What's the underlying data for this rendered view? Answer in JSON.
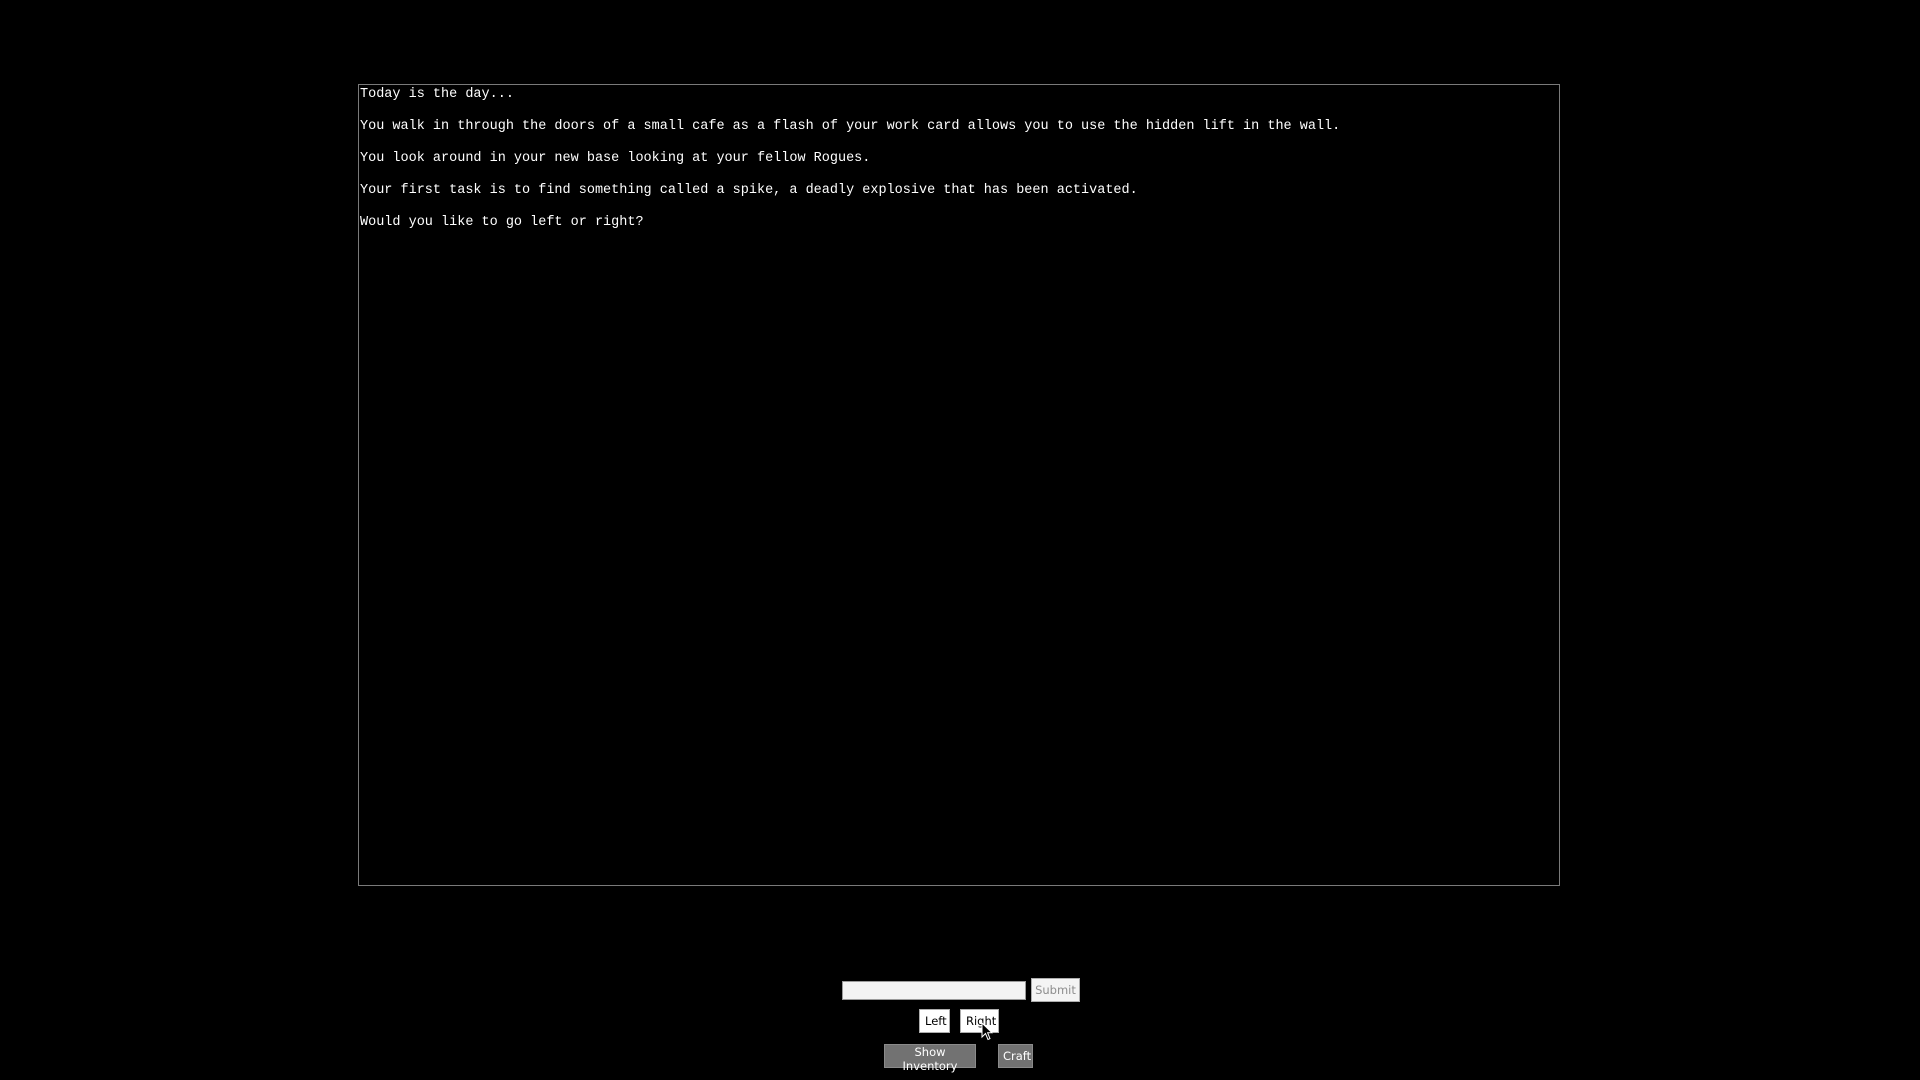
{
  "story": {
    "lines": [
      "Today is the day...",
      "You walk in through the doors of a small cafe as a flash of your work card allows you to use the hidden lift in the wall.",
      "You look around in your new base looking at your fellow Rogues.",
      "Your first task is to find something called a spike, a deadly explosive that has been activated.",
      "Would you like to go left or right?"
    ]
  },
  "input": {
    "value": "",
    "placeholder": "",
    "submit_label": "Submit"
  },
  "choices": {
    "left_label": "Left",
    "right_label": "Right"
  },
  "actions": {
    "inventory_label": "Show Inventory",
    "craft_label": "Craft"
  },
  "colors": {
    "background": "#000000",
    "text": "#ffffff",
    "panel_border": "#7a7a7a",
    "action_button": "#727272"
  },
  "icons": {
    "cursor": "mouse-pointer-icon"
  }
}
